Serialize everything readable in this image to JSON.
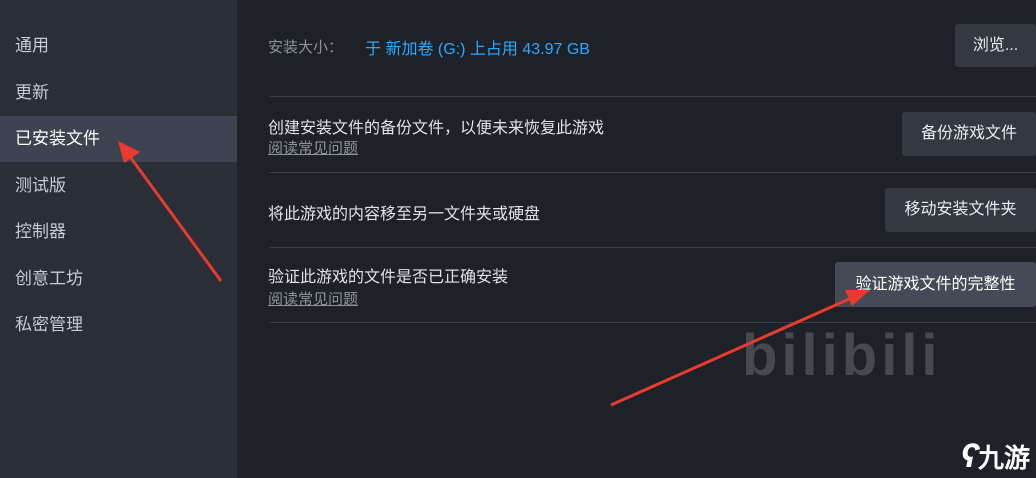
{
  "sidebar": {
    "items": [
      {
        "label": "通用"
      },
      {
        "label": "更新"
      },
      {
        "label": "已安装文件"
      },
      {
        "label": "测试版"
      },
      {
        "label": "控制器"
      },
      {
        "label": "创意工坊"
      },
      {
        "label": "私密管理"
      }
    ]
  },
  "install_size": {
    "label": "安装大小：",
    "value": "于 新加卷 (G:) 上占用 43.97 GB",
    "browse_button": "浏览..."
  },
  "backup": {
    "title": "创建安装文件的备份文件，以便未来恢复此游戏",
    "faq_link": "阅读常见问题",
    "button": "备份游戏文件"
  },
  "move": {
    "title": "将此游戏的内容移至另一文件夹或硬盘",
    "button": "移动安装文件夹"
  },
  "verify": {
    "title": "验证此游戏的文件是否已正确安装",
    "faq_link": "阅读常见问题",
    "button": "验证游戏文件的完整性"
  },
  "watermark": {
    "text": "bilibili",
    "logo_text": "九游"
  },
  "colors": {
    "accent_blue": "#2ea8ff",
    "arrow_red": "#e83a2e"
  }
}
